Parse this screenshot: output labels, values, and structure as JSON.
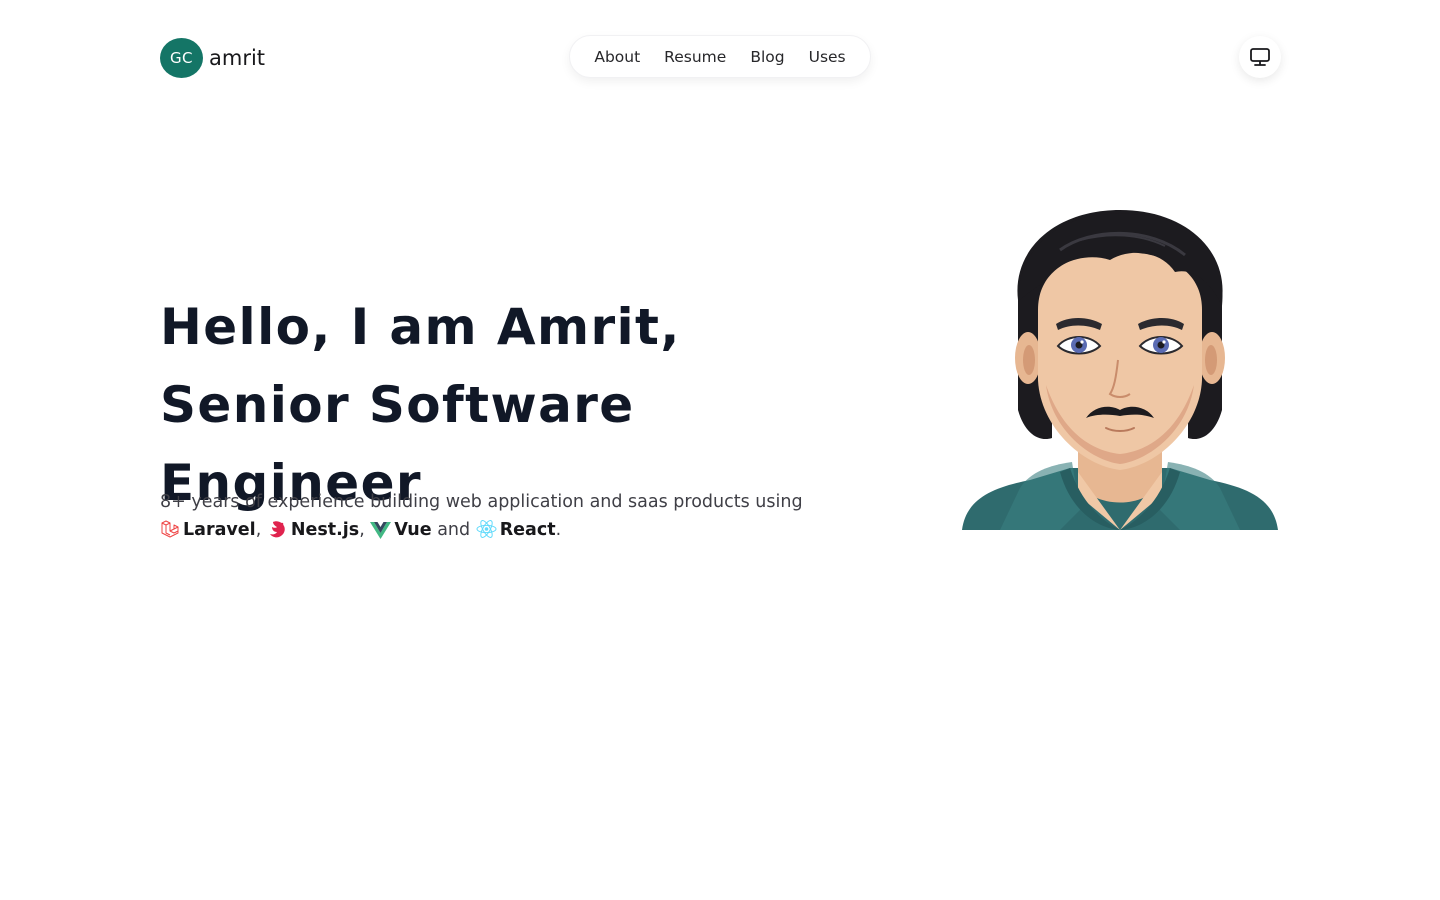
{
  "header": {
    "logo_initials": "GC",
    "logo_name": "amrit",
    "nav": [
      {
        "label": "About"
      },
      {
        "label": "Resume"
      },
      {
        "label": "Blog"
      },
      {
        "label": "Uses"
      }
    ],
    "theme_icon": "monitor-icon"
  },
  "hero": {
    "headline": "Hello, I am Amrit, Senior Software Engineer",
    "intro_text": "8+ years of experience building web application and saas products using",
    "tech": [
      {
        "name": "Laravel",
        "icon": "laravel-icon",
        "color": "#ef4444"
      },
      {
        "name": "Nest.js",
        "icon": "nestjs-icon",
        "color": "#e0234e"
      },
      {
        "name": "Vue",
        "icon": "vue-icon",
        "color": "#41b883"
      },
      {
        "name": "React",
        "icon": "react-icon",
        "color": "#61dafb"
      }
    ],
    "separator_1": ",",
    "separator_2": ",",
    "conjunction": "and",
    "period": ".",
    "avatar_icon": "avatar-illustration"
  },
  "colors": {
    "brand": "#147566",
    "text": "#111827",
    "muted": "#3f3f46"
  }
}
